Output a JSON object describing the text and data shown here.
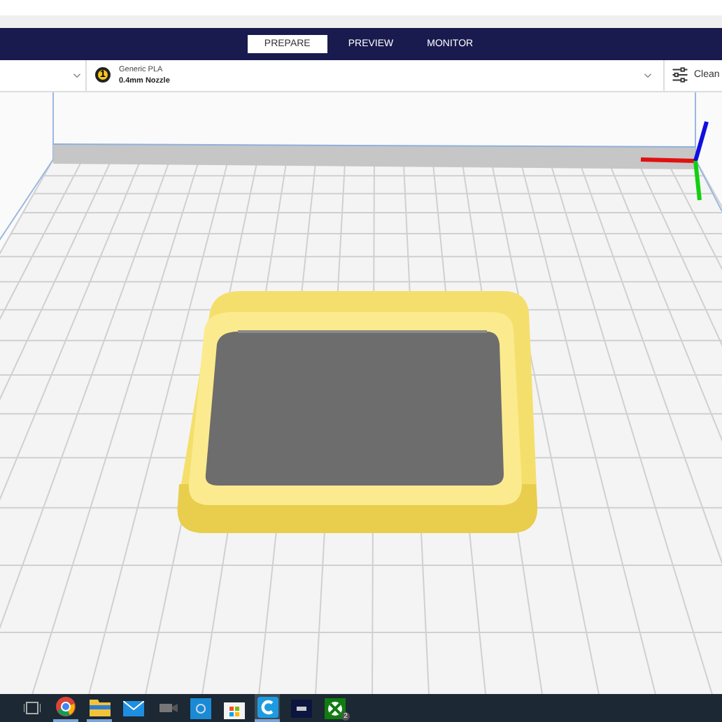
{
  "stage_tabs": [
    {
      "label": "PREPARE",
      "selected": true
    },
    {
      "label": "PREVIEW",
      "selected": false
    },
    {
      "label": "MONITOR",
      "selected": false
    }
  ],
  "extruder": {
    "number": "1",
    "material": "Generic PLA",
    "nozzle": "0.4mm Nozzle"
  },
  "print_settings": {
    "label": "Clean"
  },
  "taskbar": [
    {
      "kind": "taskview",
      "running": false,
      "selected": false
    },
    {
      "kind": "browser",
      "running": true,
      "selected": false
    },
    {
      "kind": "folder",
      "running": true,
      "selected": false
    },
    {
      "kind": "mail",
      "running": false,
      "selected": false
    },
    {
      "kind": "camera",
      "running": false,
      "selected": false
    },
    {
      "kind": "bluetile",
      "running": false,
      "selected": false
    },
    {
      "kind": "store",
      "running": false,
      "selected": false
    },
    {
      "kind": "cura",
      "running": true,
      "selected": true
    },
    {
      "kind": "terminal",
      "running": false,
      "selected": false
    },
    {
      "kind": "xbox",
      "running": false,
      "selected": false,
      "badge": "2"
    }
  ]
}
